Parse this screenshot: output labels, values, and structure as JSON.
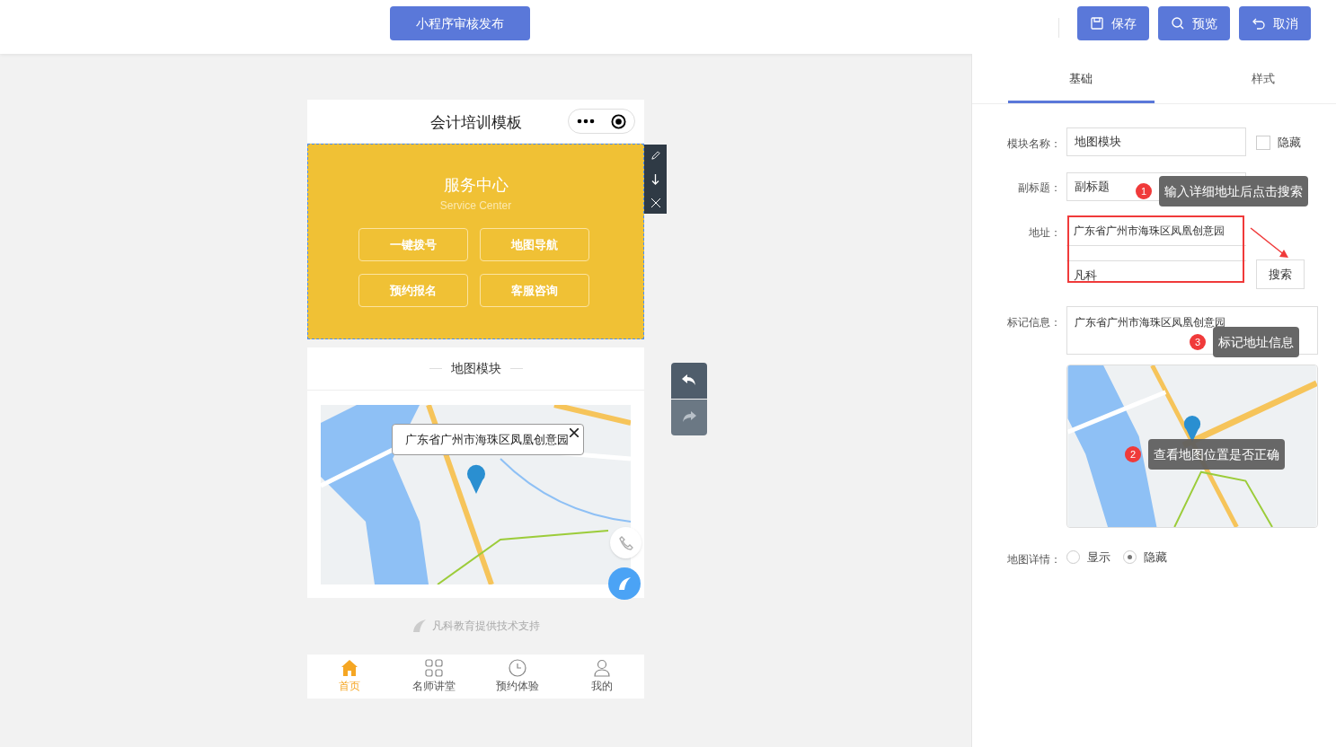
{
  "toolbar": {
    "publish_button": "小程序审核发布",
    "actions": [
      {
        "kind": "save",
        "label": "保存"
      },
      {
        "kind": "preview",
        "label": "预览"
      },
      {
        "kind": "cancel",
        "label": "取消"
      }
    ]
  },
  "phone": {
    "title": "会计培训模板",
    "service": {
      "title": "服务中心",
      "subtitle": "Service Center",
      "buttons": [
        "一键拨号",
        "地图导航",
        "预约报名",
        "客服咨询"
      ]
    },
    "map_module": {
      "title": "地图模块",
      "popup": "广东省广州市海珠区凤凰创意园"
    },
    "footer": "凡科教育提供技术支持",
    "tabbar": [
      {
        "kind": "home",
        "label": "首页",
        "selected": true
      },
      {
        "kind": "grid",
        "label": "名师讲堂",
        "selected": false
      },
      {
        "kind": "clock",
        "label": "预约体验",
        "selected": false
      },
      {
        "kind": "user",
        "label": "我的",
        "selected": false
      }
    ]
  },
  "panel": {
    "tabs": [
      {
        "label": "基础",
        "selected": true
      },
      {
        "label": "样式",
        "selected": false
      }
    ],
    "module_name": {
      "label": "模块名称：",
      "value": "地图模块",
      "hide_label": "隐藏",
      "hidden": false
    },
    "subtitle": {
      "label": "副标题：",
      "value": "副标题"
    },
    "address": {
      "label": "地址：",
      "line1": "广东省广州市海珠区凤凰创意园",
      "line2": "凡科",
      "search_button": "搜索"
    },
    "marker_info": {
      "label": "标记信息：",
      "value": "广东省广州市海珠区凤凰创意园"
    },
    "map_detail": {
      "label": "地图详情：",
      "options": [
        {
          "label": "显示",
          "selected": false
        },
        {
          "label": "隐藏",
          "selected": true
        }
      ]
    },
    "hints": [
      {
        "number": "1",
        "text": "输入详细地址后点击搜索"
      },
      {
        "number": "3",
        "text": "标记地址信息"
      },
      {
        "number": "2",
        "text": "查看地图位置是否正确"
      }
    ]
  }
}
